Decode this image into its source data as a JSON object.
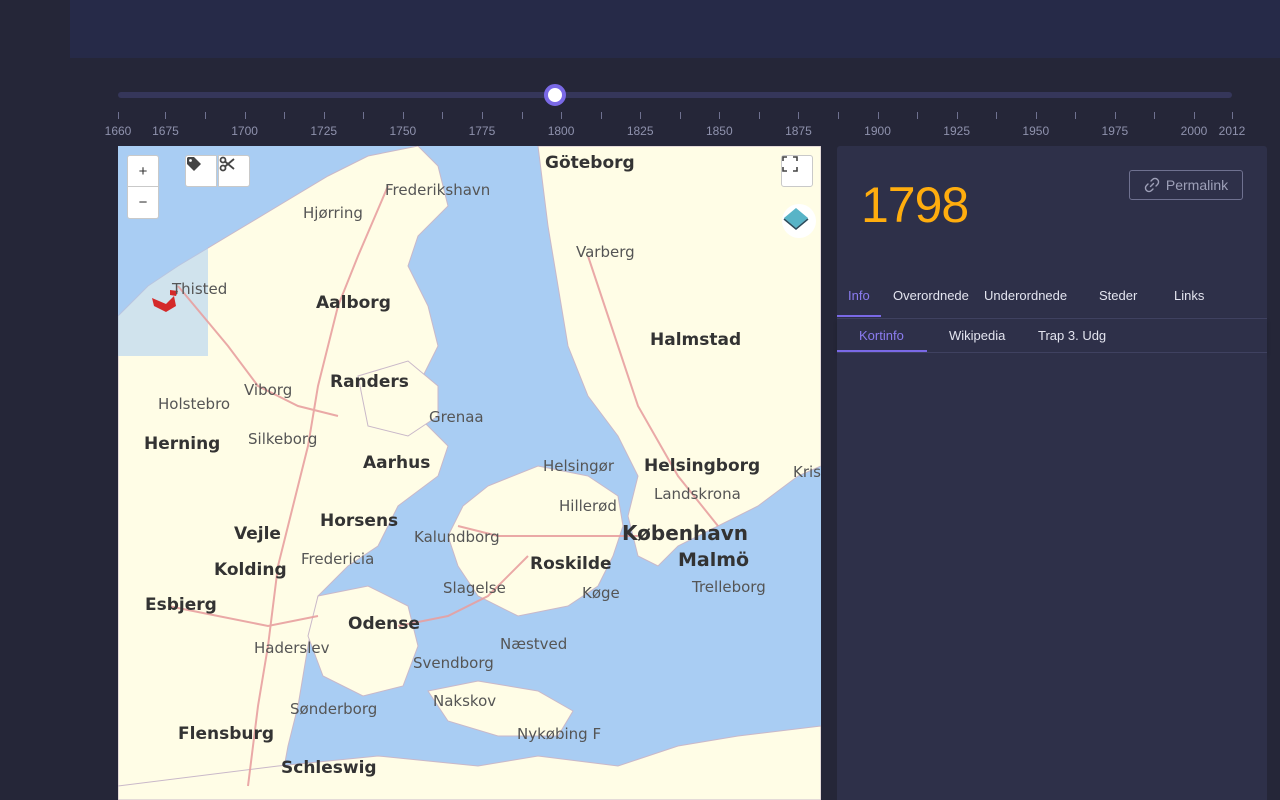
{
  "timeline": {
    "selected_year": "1798",
    "min_year": 1660,
    "max_year": 2012,
    "ticks": [
      "1660",
      "1675",
      "1700",
      "1725",
      "1750",
      "1775",
      "1800",
      "1825",
      "1850",
      "1875",
      "1900",
      "1925",
      "1950",
      "1975",
      "2000",
      "2012"
    ]
  },
  "map": {
    "zoom_in_label": "+",
    "zoom_out_label": "−",
    "tag_icon": "tag-icon",
    "scissors_icon": "scissors-icon",
    "fullscreen_icon": "fullscreen-icon",
    "layers_icon": "layers-icon",
    "places": {
      "goteborg": "Göteborg",
      "frederikshavn": "Frederikshavn",
      "hjorring": "Hjørring",
      "varberg": "Varberg",
      "thisted": "Thisted",
      "aalborg": "Aalborg",
      "halmstad": "Halmstad",
      "randers": "Randers",
      "viborg": "Viborg",
      "holstebro": "Holstebro",
      "grenaa": "Grenaa",
      "herning": "Herning",
      "silkeborg": "Silkeborg",
      "aarhus": "Aarhus",
      "helsingor": "Helsingør",
      "helsingborg": "Helsingborg",
      "landskrona": "Landskrona",
      "kris": "Kris",
      "hillerod": "Hillerød",
      "horsens": "Horsens",
      "kalundborg": "Kalundborg",
      "kobenhavn": "København",
      "vejle": "Vejle",
      "fredericia": "Fredericia",
      "malmo": "Malmö",
      "roskilde": "Roskilde",
      "trelleborg": "Trelleborg",
      "kolding": "Kolding",
      "slagelse": "Slagelse",
      "koge": "Køge",
      "esbjerg": "Esbjerg",
      "odense": "Odense",
      "naestved": "Næstved",
      "haderslev": "Haderslev",
      "svendborg": "Svendborg",
      "nakskov": "Nakskov",
      "sonderborg": "Sønderborg",
      "nykobing": "Nykøbing F",
      "flensburg": "Flensburg",
      "schleswig": "Schleswig"
    },
    "colors": {
      "water": "#a9cdf3",
      "land": "#fffde6",
      "highlight": "#d42a2a"
    }
  },
  "panel": {
    "year": "1798",
    "permalink_label": "Permalink",
    "link_icon": "link-icon",
    "tabs": [
      "Info",
      "Overordnede",
      "Underordnede",
      "Steder",
      "Links"
    ],
    "active_tab": "Info",
    "subtabs": [
      "Kortinfo",
      "Wikipedia",
      "Trap 3. Udg"
    ],
    "active_subtab": "Kortinfo"
  },
  "colors": {
    "accent": "#7a69e6",
    "year": "#ffad0e",
    "background": "#252638",
    "panel": "#2e3049"
  }
}
